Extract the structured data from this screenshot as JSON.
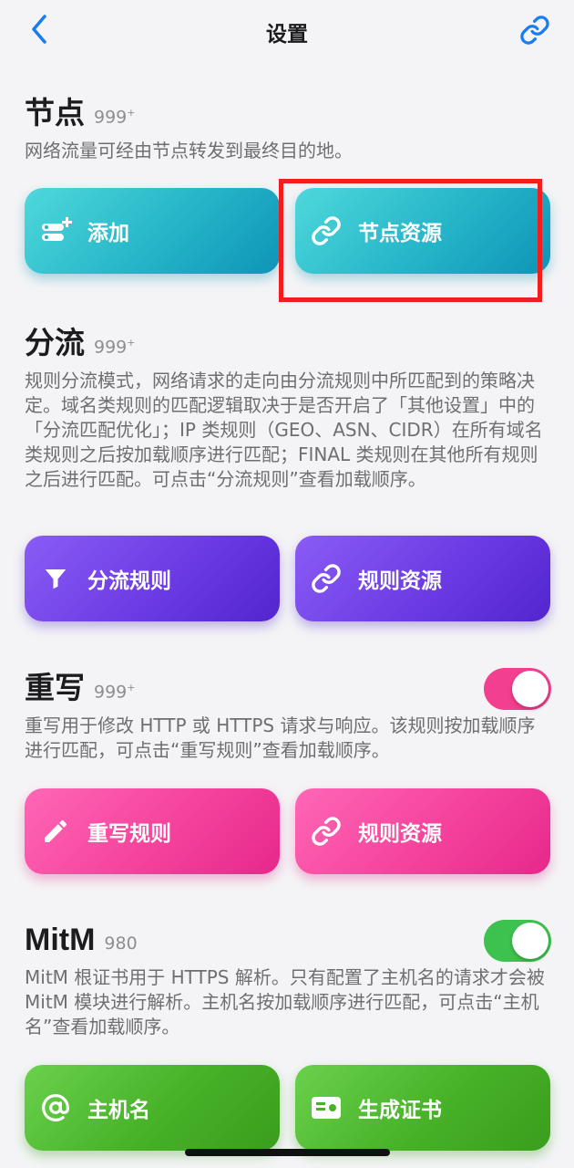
{
  "nav": {
    "title": "设置",
    "back_icon": "chevron-left-icon",
    "link_icon": "link-icon",
    "accent": "#1a7cf0"
  },
  "nodes": {
    "title": "节点",
    "count": "999",
    "count_sup": "+",
    "desc": "网络流量可经由节点转发到最终目的地。",
    "buttons": {
      "add": "添加",
      "resources": "节点资源"
    }
  },
  "routing": {
    "title": "分流",
    "count": "999",
    "count_sup": "+",
    "desc": "规则分流模式，网络请求的走向由分流规则中所匹配到的策略决定。域名类规则的匹配逻辑取决于是否开启了「其他设置」中的「分流匹配优化」；IP 类规则（GEO、ASN、CIDR）在所有域名类规则之后按加载顺序进行匹配；FINAL 类规则在其他所有规则之后进行匹配。可点击“分流规则”查看加载顺序。",
    "buttons": {
      "rules": "分流规则",
      "resources": "规则资源"
    }
  },
  "rewrite": {
    "title": "重写",
    "count": "999",
    "count_sup": "+",
    "enabled": true,
    "toggle_color": "#f23f8f",
    "desc": "重写用于修改 HTTP 或 HTTPS 请求与响应。该规则按加载顺序进行匹配，可点击“重写规则”查看加载顺序。",
    "buttons": {
      "rules": "重写规则",
      "resources": "规则资源"
    }
  },
  "mitm": {
    "title": "MitM",
    "count": "980",
    "enabled": true,
    "toggle_color": "#3ec24f",
    "desc": "MitM 根证书用于 HTTPS 解析。只有配置了主机名的请求才会被 MitM 模块进行解析。主机名按加载顺序进行匹配，可点击“主机名”查看加载顺序。",
    "buttons": {
      "hostname": "主机名",
      "certificate": "生成证书"
    }
  }
}
